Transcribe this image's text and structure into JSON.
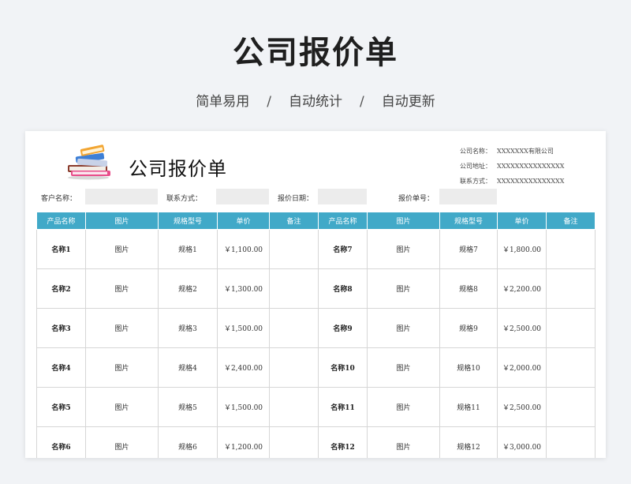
{
  "hero": {
    "title": "公司报价单",
    "tagline": [
      "简单易用",
      "自动统计",
      "自动更新"
    ],
    "separator": "/"
  },
  "document": {
    "title": "公司报价单",
    "logo_icon": "stack-of-books-icon",
    "company": {
      "name_label": "公司名称：",
      "name_value": "XXXXXXX有限公司",
      "address_label": "公司地址：",
      "address_value": "XXXXXXXXXXXXXXX",
      "contact_label": "联系方式：",
      "contact_value": "XXXXXXXXXXXXXXX"
    },
    "fields": {
      "customer_label": "客户名称：",
      "customer_value": "",
      "contact_label": "联系方式：",
      "contact_value": "",
      "date_label": "报价日期：",
      "date_value": "",
      "number_label": "报价单号：",
      "number_value": ""
    },
    "table": {
      "headers": [
        "产品名称",
        "图片",
        "规格型号",
        "单价",
        "备注",
        "产品名称",
        "图片",
        "规格型号",
        "单价",
        "备注"
      ],
      "rows": [
        [
          {
            "name": "名称1",
            "image": "图片",
            "spec": "规格1",
            "price": "￥1,100.00",
            "note": ""
          },
          {
            "name": "名称7",
            "image": "图片",
            "spec": "规格7",
            "price": "￥1,800.00",
            "note": ""
          }
        ],
        [
          {
            "name": "名称2",
            "image": "图片",
            "spec": "规格2",
            "price": "￥1,300.00",
            "note": ""
          },
          {
            "name": "名称8",
            "image": "图片",
            "spec": "规格8",
            "price": "￥2,200.00",
            "note": ""
          }
        ],
        [
          {
            "name": "名称3",
            "image": "图片",
            "spec": "规格3",
            "price": "￥1,500.00",
            "note": ""
          },
          {
            "name": "名称9",
            "image": "图片",
            "spec": "规格9",
            "price": "￥2,500.00",
            "note": ""
          }
        ],
        [
          {
            "name": "名称4",
            "image": "图片",
            "spec": "规格4",
            "price": "￥2,400.00",
            "note": ""
          },
          {
            "name": "名称10",
            "image": "图片",
            "spec": "规格10",
            "price": "￥2,000.00",
            "note": ""
          }
        ],
        [
          {
            "name": "名称5",
            "image": "图片",
            "spec": "规格5",
            "price": "￥1,500.00",
            "note": ""
          },
          {
            "name": "名称11",
            "image": "图片",
            "spec": "规格11",
            "price": "￥2,500.00",
            "note": ""
          }
        ],
        [
          {
            "name": "名称6",
            "image": "图片",
            "spec": "规格6",
            "price": "￥1,200.00",
            "note": ""
          },
          {
            "name": "名称12",
            "image": "图片",
            "spec": "规格12",
            "price": "￥3,000.00",
            "note": ""
          }
        ]
      ]
    }
  },
  "colors": {
    "header_bg": "#41a9c8",
    "page_bg": "#f1f3f6",
    "field_box": "#ececec"
  }
}
